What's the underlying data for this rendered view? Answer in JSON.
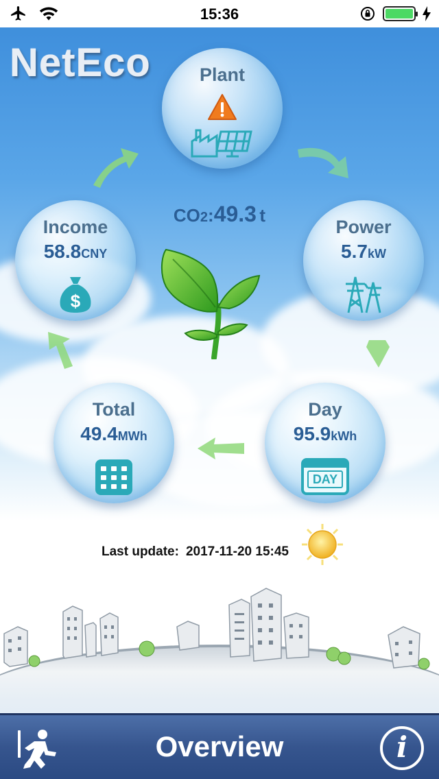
{
  "status_bar": {
    "time": "15:36"
  },
  "app": {
    "logo": "NetEco"
  },
  "plant": {
    "title": "Plant",
    "status_icon": "warning-icon"
  },
  "income": {
    "title": "Income",
    "value": "58.8",
    "unit": "CNY"
  },
  "power": {
    "title": "Power",
    "value": "5.7",
    "unit": "kW"
  },
  "total": {
    "title": "Total",
    "value": "49.4",
    "unit": "MWh"
  },
  "day": {
    "title": "Day",
    "value": "95.9",
    "unit": "kWh",
    "icon_text": "DAY"
  },
  "co2": {
    "label": "CO",
    "sub": "2",
    "colon": ":",
    "value": "49.3",
    "unit": "t"
  },
  "last_update": {
    "label": "Last update:",
    "value": "2017-11-20 15:45"
  },
  "tab_bar": {
    "title": "Overview",
    "info_glyph": "i"
  },
  "colors": {
    "sky": "#3f8fdc",
    "value_blue": "#2a5d95",
    "tab_bar": "#36558e",
    "battery": "#4cd964",
    "warning": "#f07b1e"
  }
}
